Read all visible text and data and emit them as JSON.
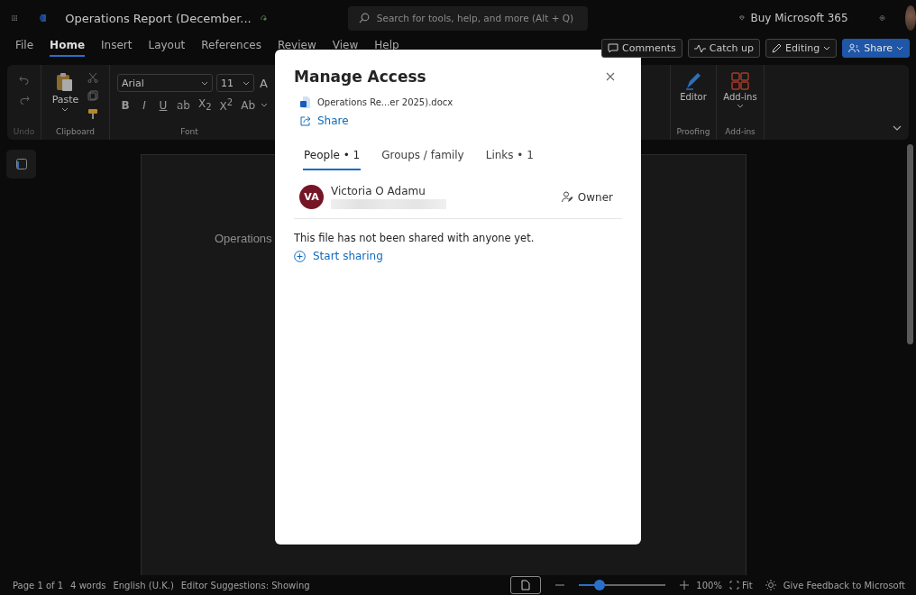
{
  "app_bar": {
    "title": "Operations Report (December...",
    "search": {
      "placeholder": "Search for tools, help, and more (Alt + Q)"
    },
    "buy_label": "Buy Microsoft 365"
  },
  "menu_tabs": [
    {
      "label": "File",
      "selected": false
    },
    {
      "label": "Home",
      "selected": true
    },
    {
      "label": "Insert",
      "selected": false
    },
    {
      "label": "Layout",
      "selected": false
    },
    {
      "label": "References",
      "selected": false
    },
    {
      "label": "Review",
      "selected": false
    },
    {
      "label": "View",
      "selected": false
    },
    {
      "label": "Help",
      "selected": false
    }
  ],
  "actions": [
    {
      "kind": "comments",
      "label": "Comments"
    },
    {
      "kind": "catchup",
      "label": "Catch up"
    },
    {
      "kind": "editing",
      "label": "Editing"
    },
    {
      "kind": "share",
      "label": "Share"
    }
  ],
  "ribbon": {
    "undo_group": "Undo",
    "clipboard": {
      "paste": "Paste",
      "group": "Clipboard"
    },
    "font": {
      "name": "Arial",
      "size": "11",
      "grow": "A",
      "group": "Font",
      "format_buttons": [
        {
          "kind": "bold",
          "label": "B"
        },
        {
          "kind": "italic",
          "label": "I"
        },
        {
          "kind": "underline",
          "label": "U"
        },
        {
          "kind": "strike",
          "label": "ab"
        },
        {
          "kind": "plain",
          "label": "X$_{2}$"
        },
        {
          "kind": "plain",
          "label": "X$^{2}$"
        },
        {
          "kind": "plain",
          "label": "Ab"
        }
      ]
    },
    "proofing": {
      "editor": "Editor",
      "group": "Proofing"
    },
    "addins": {
      "button": "Add-ins",
      "group": "Add-ins"
    }
  },
  "document": {
    "text": "Operations"
  },
  "dialog": {
    "title": "Manage Access",
    "file": "Operations Re...er 2025).docx",
    "share": "Share",
    "tabs": [
      {
        "label": "People • 1",
        "selected": true
      },
      {
        "label": "Groups / family",
        "selected": false
      },
      {
        "label": "Links • 1",
        "selected": false
      }
    ],
    "people": [
      {
        "initials": "VA",
        "name": "Victoria O Adamu",
        "role": "Owner"
      }
    ],
    "message": "This file has not been shared with anyone yet.",
    "start_sharing": "Start sharing"
  },
  "status_bar": {
    "page": "Page 1 of 1",
    "words": "4 words",
    "language": "English (U.K.)",
    "suggestions": "Editor Suggestions: Showing",
    "zoom": {
      "level": 0.2
    },
    "zoom_value": "100%",
    "fit": "Fit",
    "feedback": "Give Feedback to Microsoft"
  }
}
